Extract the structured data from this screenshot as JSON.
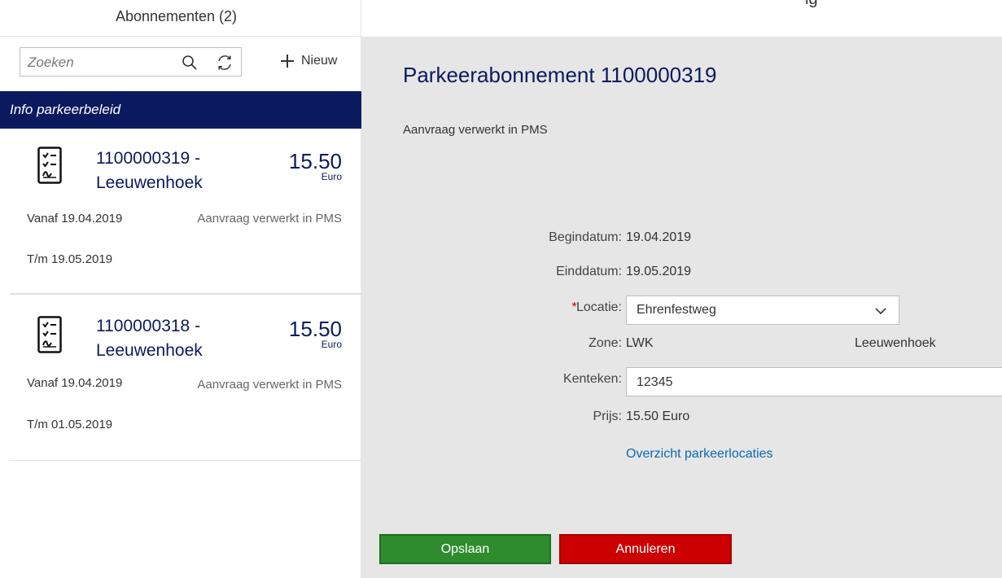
{
  "left": {
    "header": "Abonnementen (2)",
    "search": {
      "placeholder": "Zoeken",
      "value": ""
    },
    "new_label": "Nieuw",
    "policy_label": "Info parkeerbeleid",
    "subscriptions": [
      {
        "title_line1": "1100000319 -",
        "title_line2": "Leeuwenhoek",
        "price": "15.50",
        "unit": "Euro",
        "from": "Vanaf 19.04.2019",
        "status": "Aanvraag verwerkt in PMS",
        "to": "T/m 19.05.2019"
      },
      {
        "title_line1": "1100000318 -",
        "title_line2": "Leeuwenhoek",
        "price": "15.50",
        "unit": "Euro",
        "from": "Vanaf 19.04.2019",
        "status": "Aanvraag verwerkt in PMS",
        "to": "T/m 01.05.2019"
      }
    ]
  },
  "detail": {
    "top_cut_text": "ig",
    "title": "Parkeerabonnement 1100000319",
    "status": "Aanvraag verwerkt in PMS",
    "fields": {
      "begin_label": "Begindatum:",
      "begin_value": "19.04.2019",
      "end_label": "Einddatum:",
      "end_value": "19.05.2019",
      "location_required_mark": "*",
      "location_label": "Locatie:",
      "location_value": "Ehrenfestweg",
      "zone_label": "Zone:",
      "zone_code": "LWK",
      "zone_name": "Leeuwenhoek",
      "plate_label": "Kenteken:",
      "plate_value": "12345",
      "price_label": "Prijs:",
      "price_value": "15.50 Euro"
    },
    "overview_link": "Overzicht parkeerlocaties",
    "save_label": "Opslaan",
    "cancel_label": "Annuleren"
  },
  "colors": {
    "brand_navy": "#0b1a5e",
    "save_green": "#2e8b2e",
    "cancel_red": "#cc0000",
    "link_blue": "#0a6ab0",
    "detail_bg": "#e6e6e6"
  }
}
